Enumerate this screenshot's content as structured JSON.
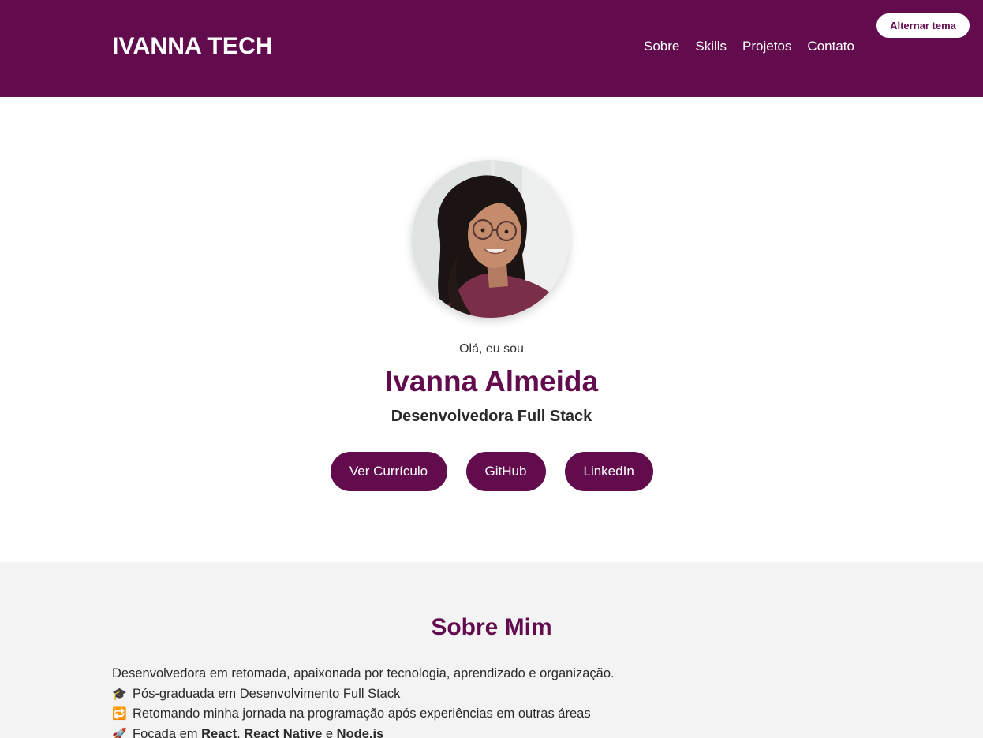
{
  "header": {
    "brand": "IVANNA TECH",
    "nav": [
      "Sobre",
      "Skills",
      "Projetos",
      "Contato"
    ],
    "theme_button": "Alternar tema"
  },
  "hero": {
    "greeting": "Olá, eu sou",
    "name": "Ivanna Almeida",
    "role": "Desenvolvedora Full Stack",
    "buttons": {
      "cv": "Ver Currículo",
      "github": "GitHub",
      "linkedin": "LinkedIn"
    }
  },
  "about": {
    "title": "Sobre Mim",
    "intro": "Desenvolvedora em retomada, apaixonada por tecnologia, aprendizado e organização.",
    "items": [
      {
        "icon": "graduation-cap-icon",
        "emoji": "🎓",
        "text": "Pós-graduada em Desenvolvimento Full Stack"
      },
      {
        "icon": "repeat-icon",
        "emoji": "🔁",
        "text": "Retomando minha jornada na programação após experiências em outras áreas"
      },
      {
        "icon": "rocket-icon",
        "emoji": "🚀",
        "prefix": "Focada em ",
        "tech1": "React",
        "sep1": ", ",
        "tech2": "React Native",
        "sep2": " e ",
        "tech3": "Node.js"
      }
    ]
  },
  "colors": {
    "primary": "#620c4e",
    "about_bg": "#f3f3f3",
    "text": "#2a2a2a"
  }
}
